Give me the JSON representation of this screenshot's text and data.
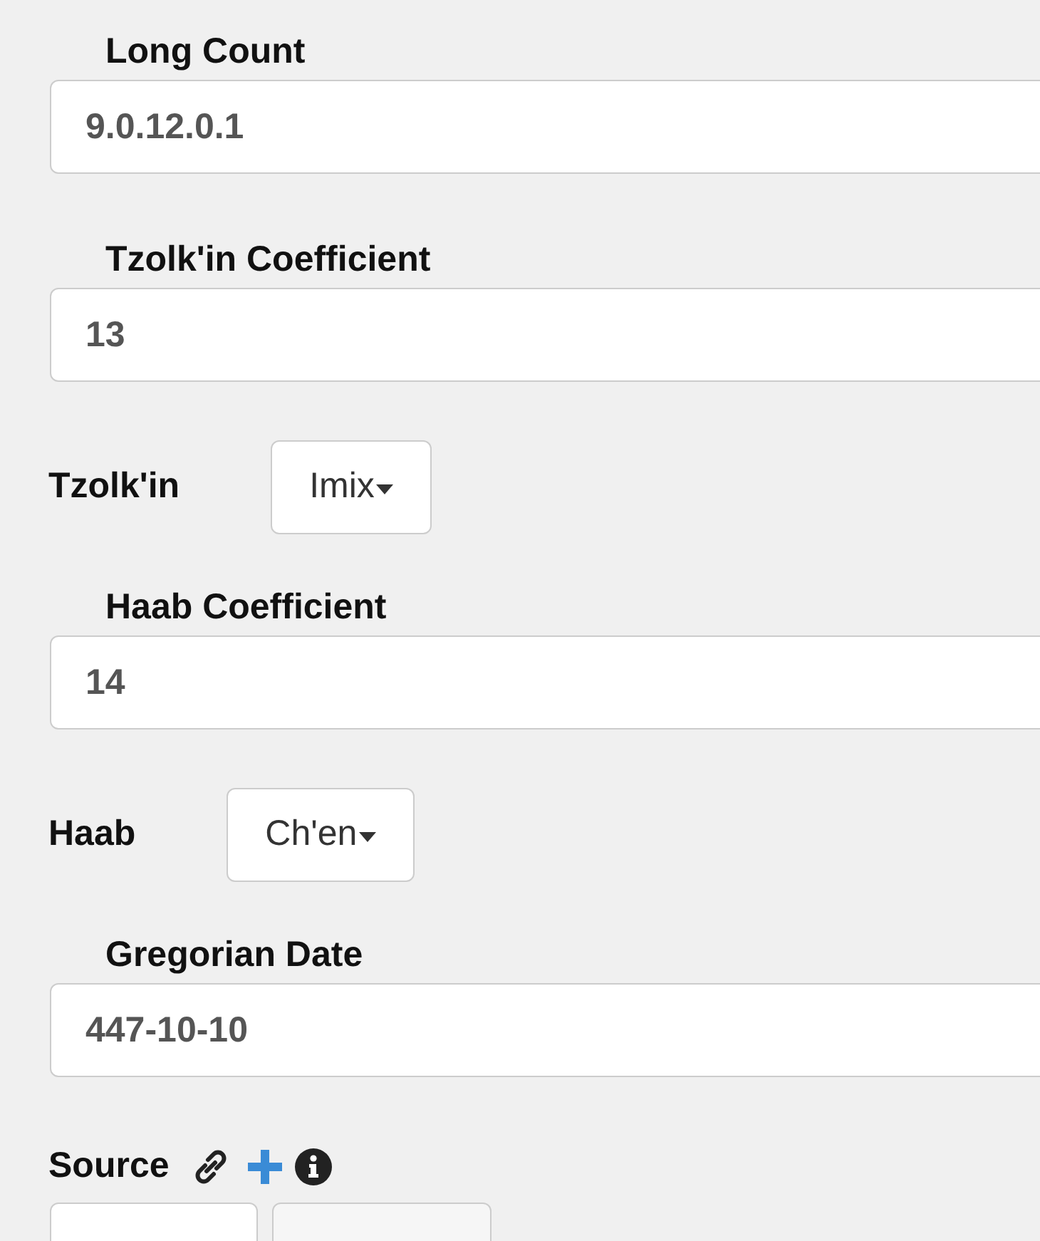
{
  "fields": [
    {
      "kind": "input",
      "label": "Long Count",
      "value": "9.0.12.0.1"
    },
    {
      "kind": "input",
      "label": "Tzolk'in Coefficient",
      "value": "13"
    },
    {
      "kind": "dropdown",
      "label": "Tzolk'in",
      "value": "Imix"
    },
    {
      "kind": "input",
      "label": "Haab Coefficient",
      "value": "14"
    },
    {
      "kind": "dropdown",
      "label": "Haab",
      "value": "Ch'en"
    },
    {
      "kind": "input",
      "label": "Gregorian Date",
      "value": "447-10-10"
    }
  ],
  "source": {
    "label": "Source",
    "buttons": [
      {
        "kind": "plain"
      },
      {
        "kind": "muted"
      }
    ]
  }
}
